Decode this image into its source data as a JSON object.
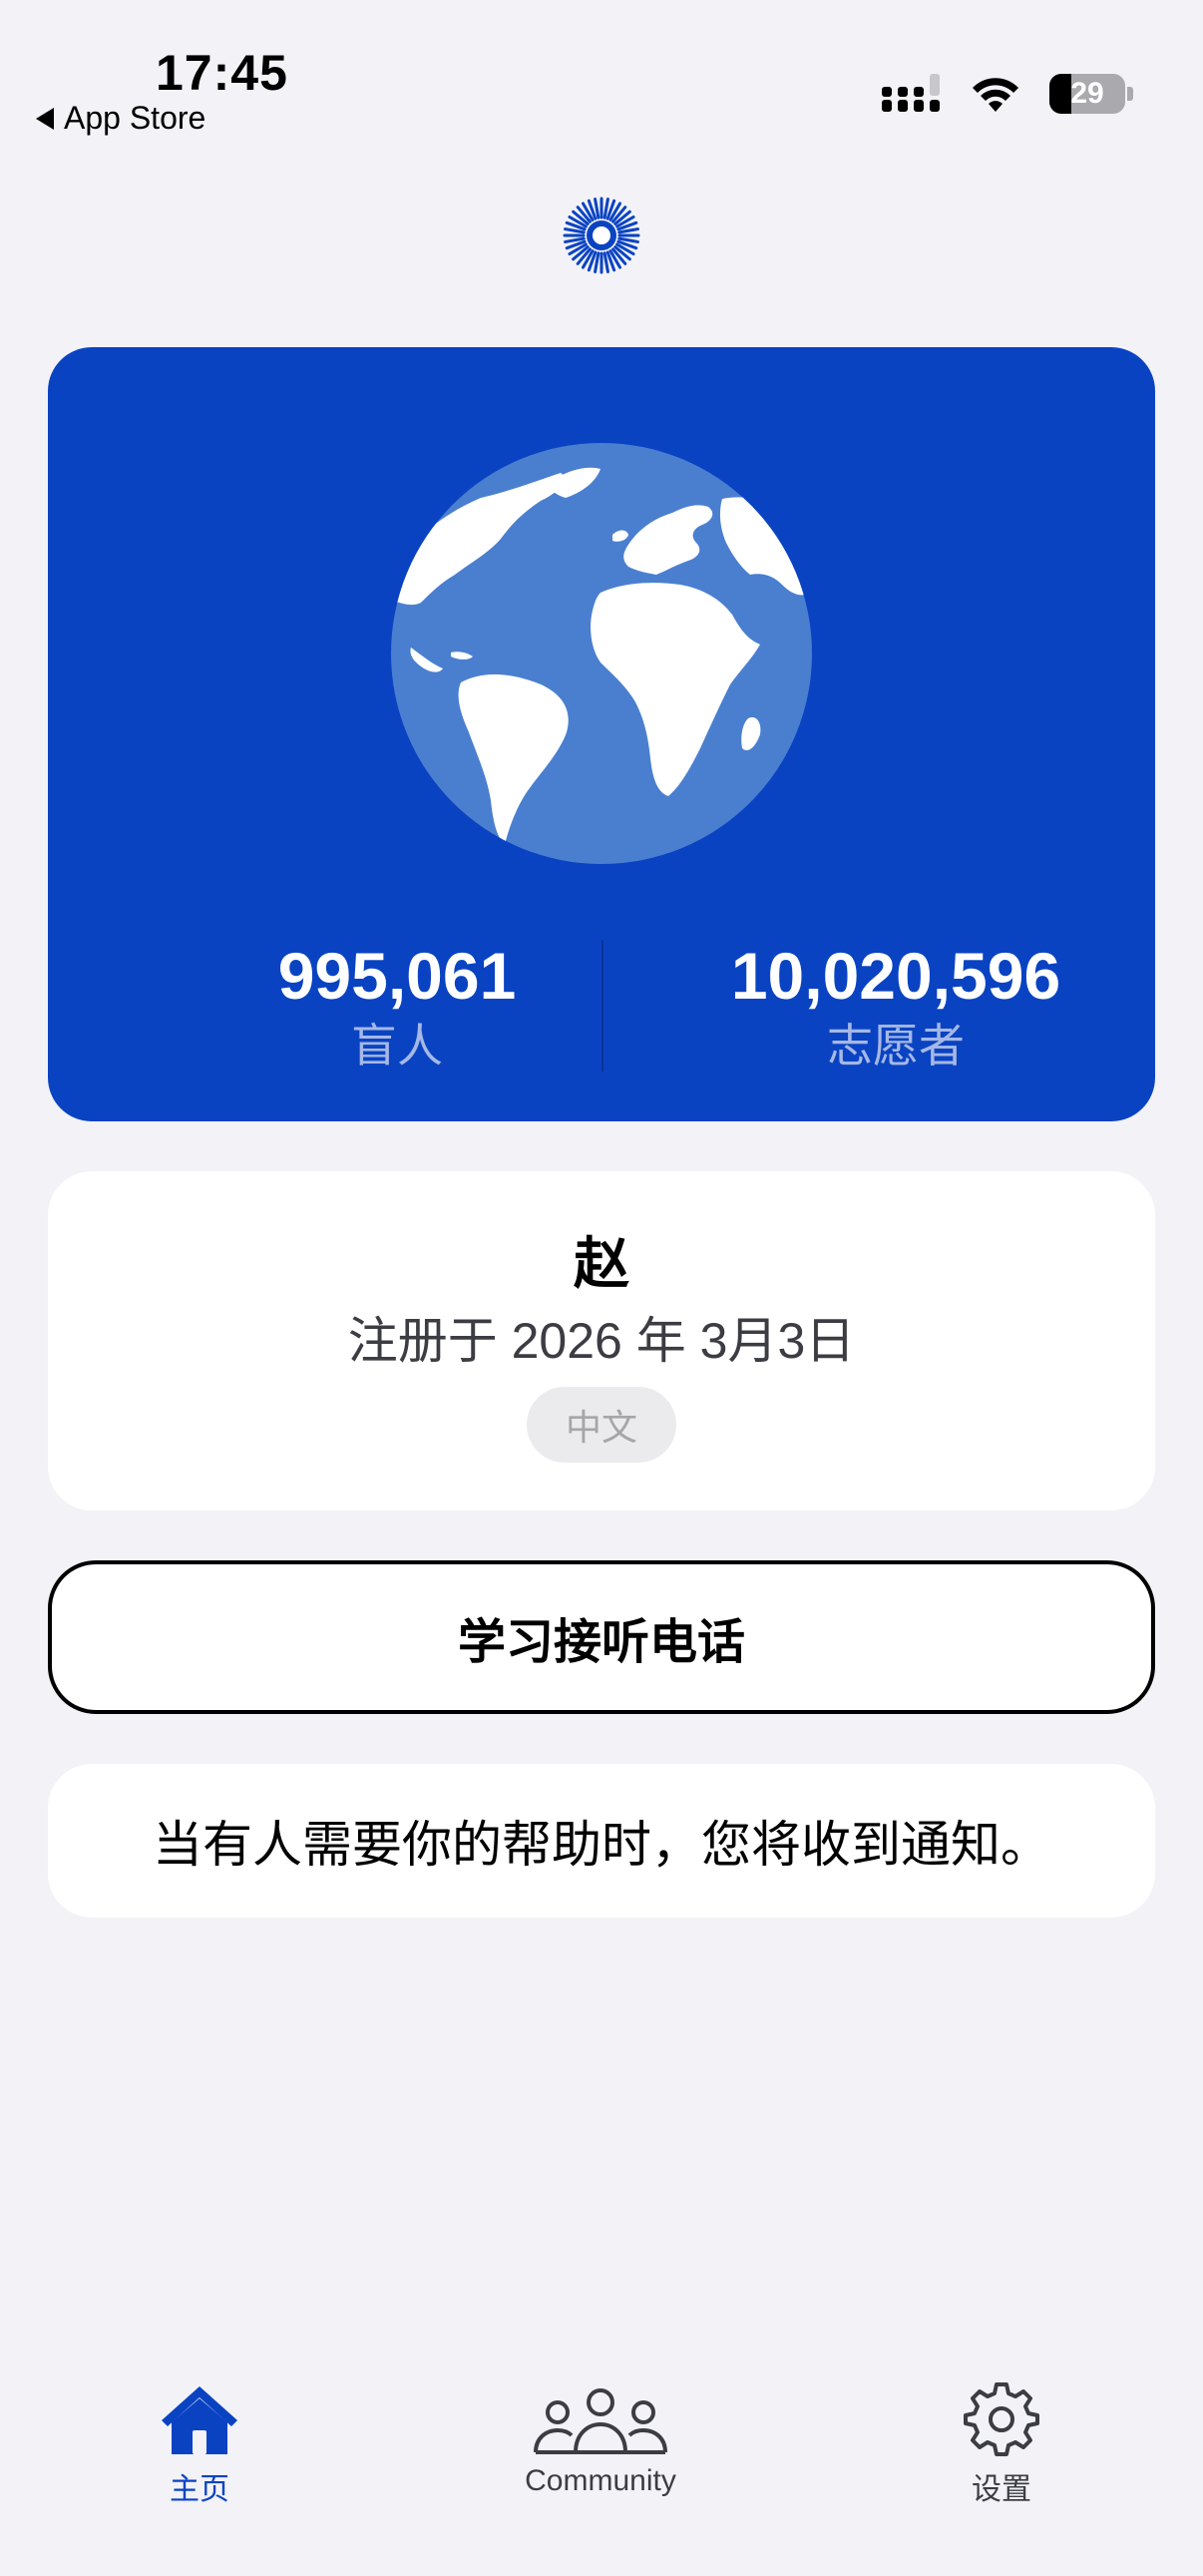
{
  "status_bar": {
    "time": "17:45",
    "back_app": "App Store",
    "battery": "29"
  },
  "stats": {
    "blind_count": "995,061",
    "blind_label": "盲人",
    "volunteer_count": "10,020,596",
    "volunteer_label": "志愿者"
  },
  "profile": {
    "name": "赵",
    "registered": "注册于 2026 年 3月3日",
    "language": "中文"
  },
  "learn_button": "学习接听电话",
  "notice": "当有人需要你的帮助时，您将收到通知。",
  "tabs": [
    {
      "label": "主页",
      "icon": "home-icon",
      "active": true
    },
    {
      "label": "Community",
      "icon": "community-icon",
      "active": false
    },
    {
      "label": "设置",
      "icon": "gear-icon",
      "active": false
    }
  ],
  "colors": {
    "brand_blue": "#0a43c2",
    "background": "#f2f2f7"
  }
}
